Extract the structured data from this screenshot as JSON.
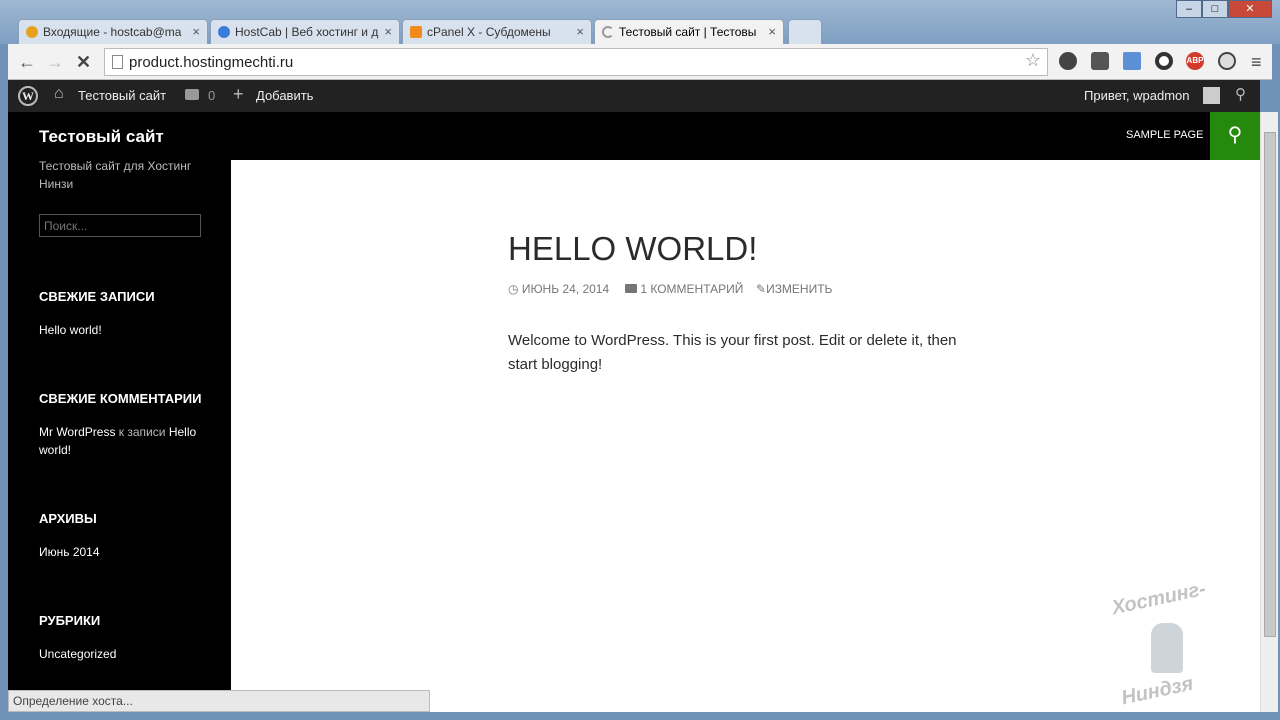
{
  "browser": {
    "tabs": [
      {
        "label": "Входящие - hostcab@ma",
        "close": "×"
      },
      {
        "label": "HostCab | Веб хостинг и д",
        "close": "×"
      },
      {
        "label": "cPanel X - Субдомены",
        "close": "×"
      },
      {
        "label": "Тестовый сайт | Тестовы",
        "close": "×"
      }
    ],
    "url": "product.hostingmechti.ru",
    "status": "Определение хоста...",
    "extensions": {
      "abp": "ABP"
    }
  },
  "adminbar": {
    "site": "Тестовый сайт",
    "comments": "0",
    "add": "Добавить",
    "greeting": "Привет, wpadmon"
  },
  "site": {
    "title": "Тестовый сайт",
    "description": "Тестовый сайт для Хостинг Нинзи",
    "menu": "SAMPLE PAGE",
    "search_placeholder": "Поиск..."
  },
  "widgets": {
    "recent_posts": {
      "title": "СВЕЖИЕ ЗАПИСИ",
      "item": "Hello world!"
    },
    "recent_comments": {
      "title": "СВЕЖИЕ КОММЕНТАРИИ",
      "author": "Mr WordPress",
      "mid": "к записи",
      "post": "Hello world!"
    },
    "archives": {
      "title": "АРХИВЫ",
      "item": "Июнь 2014"
    },
    "categories": {
      "title": "РУБРИКИ",
      "item": "Uncategorized"
    }
  },
  "post": {
    "title": "HELLO WORLD!",
    "date": "ИЮНЬ 24, 2014",
    "comments": "1 КОММЕНТАРИЙ",
    "edit": "ИЗМЕНИТЬ",
    "body": "Welcome to WordPress. This is your first post. Edit or delete it, then start blogging!"
  },
  "watermark": {
    "top": "Хостинг-",
    "bottom": "Ниндзя"
  }
}
